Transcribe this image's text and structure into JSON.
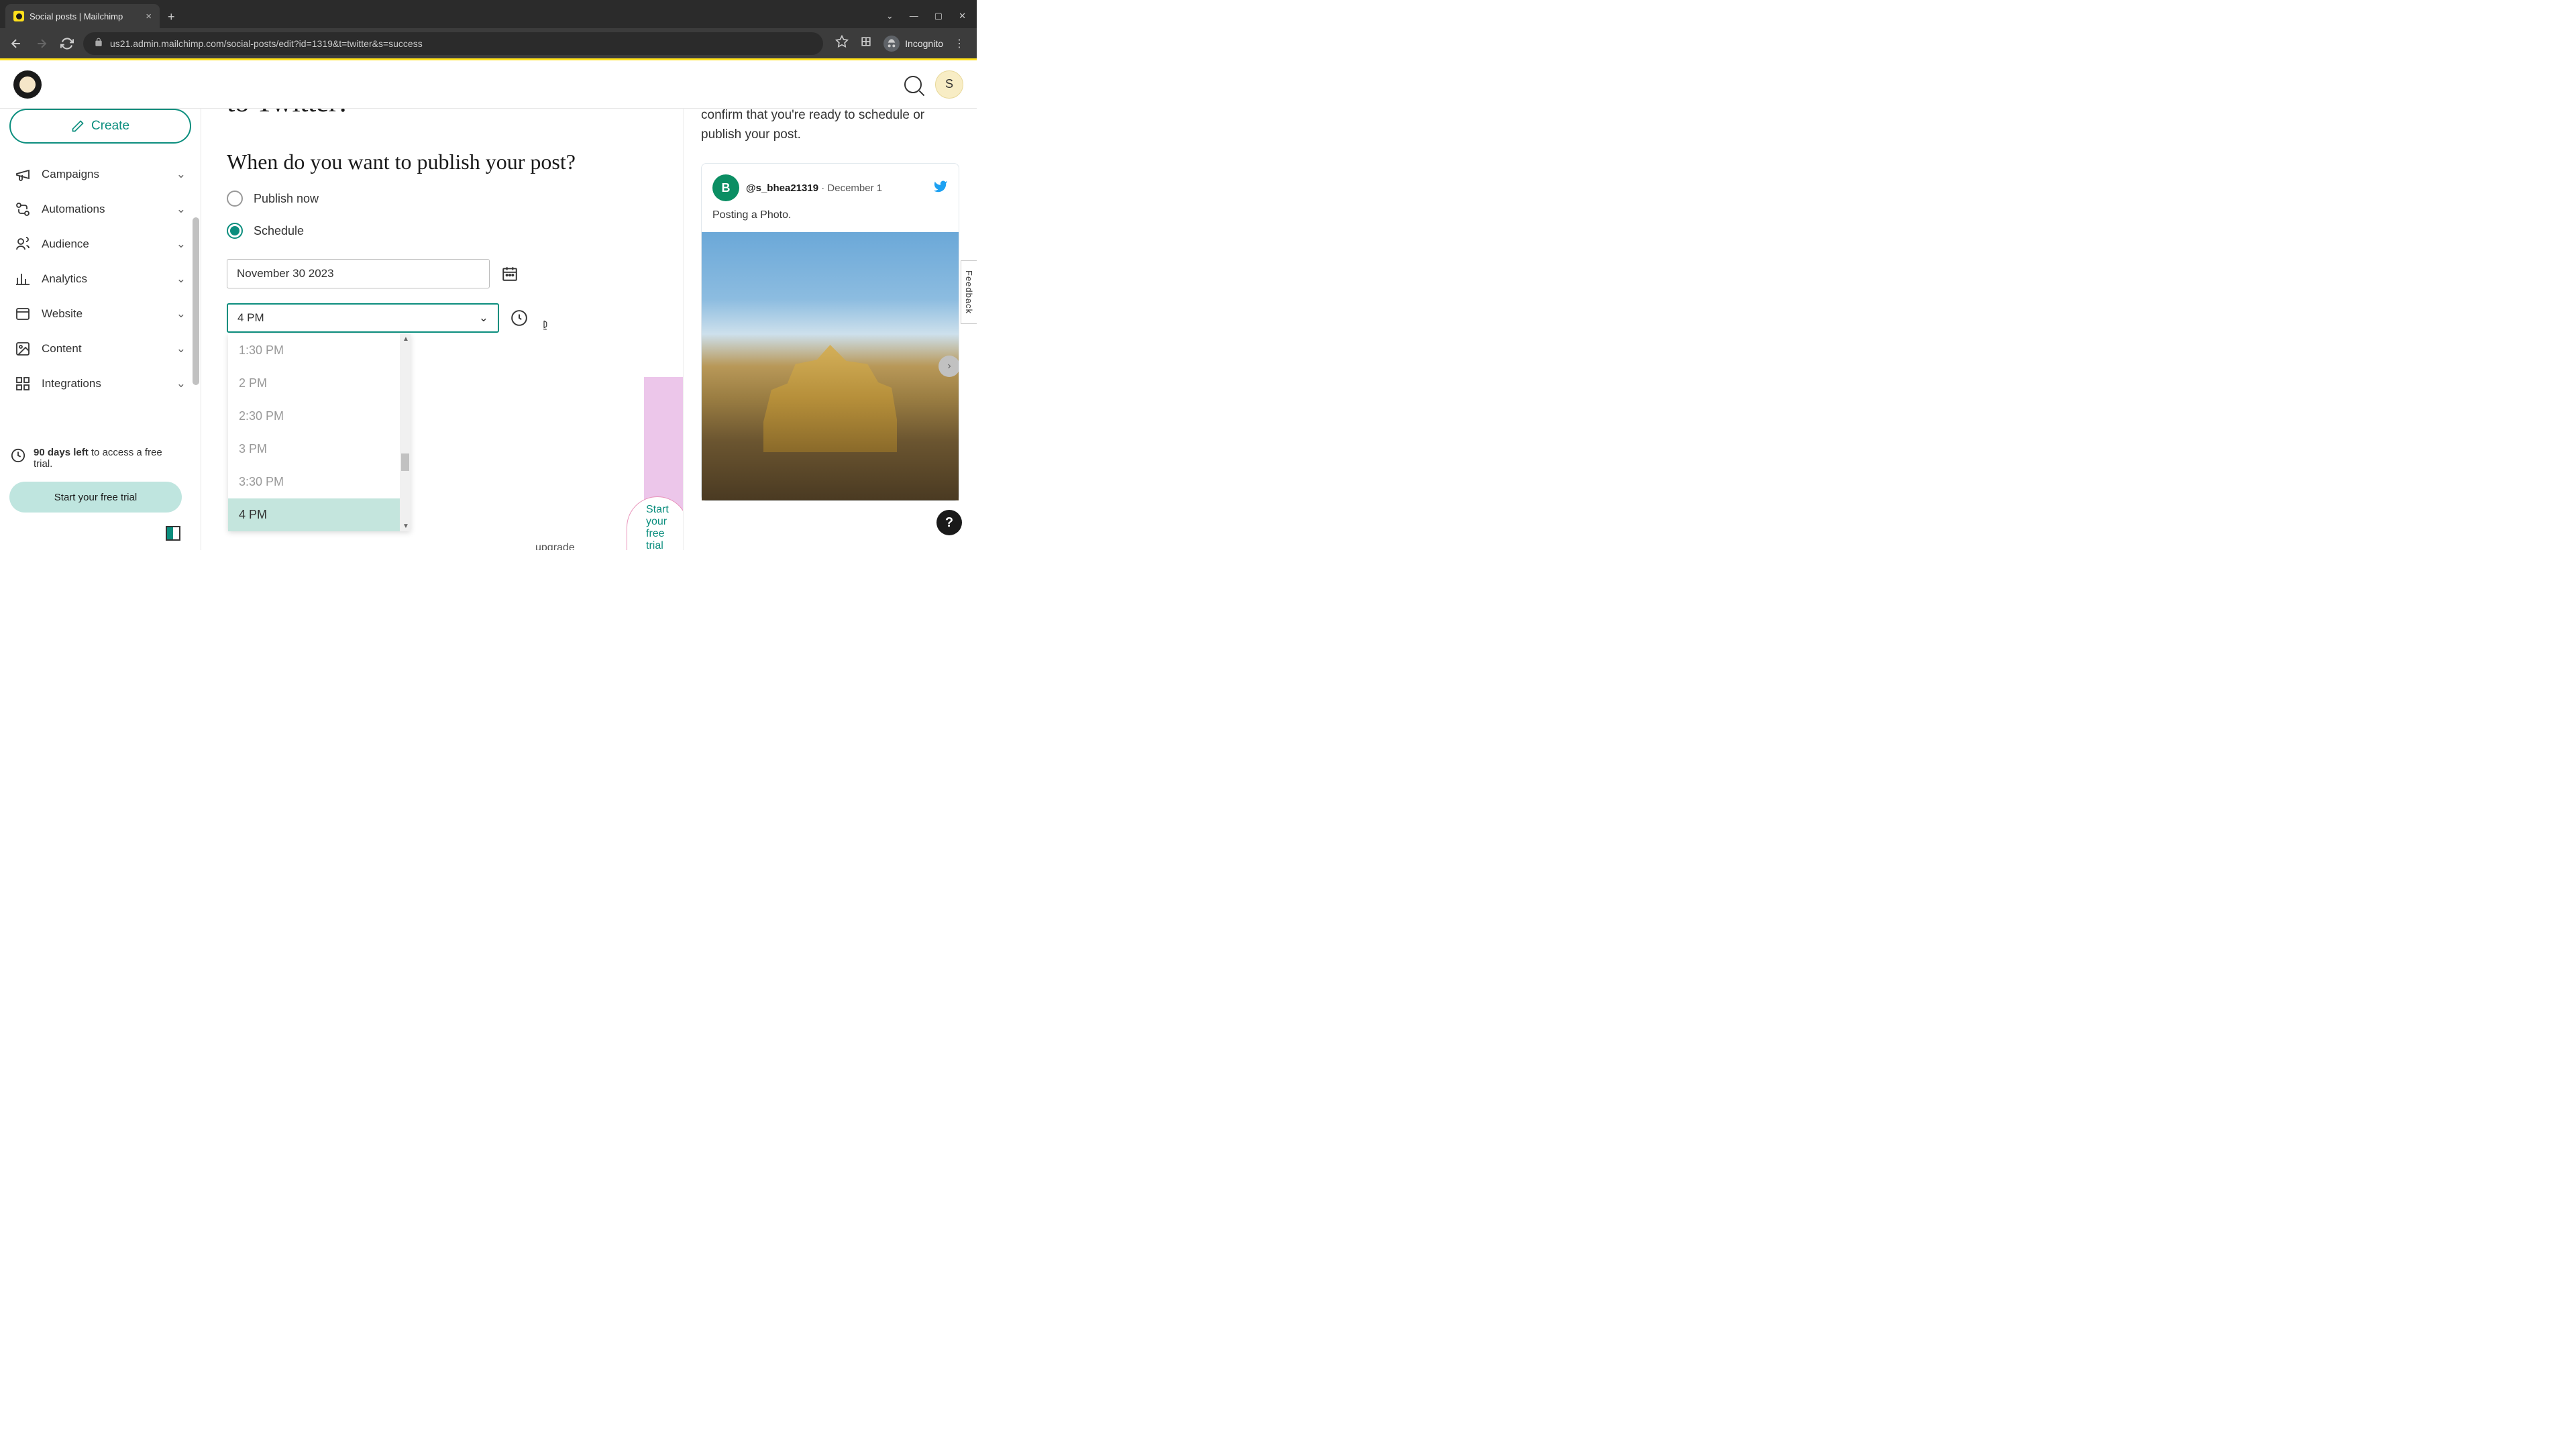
{
  "browser": {
    "tab_title": "Social posts | Mailchimp",
    "url": "us21.admin.mailchimp.com/social-posts/edit?id=1319&t=twitter&s=success",
    "incognito_label": "Incognito"
  },
  "header": {
    "avatar_letter": "S"
  },
  "sidebar": {
    "create_label": "Create",
    "items": [
      {
        "label": "Campaigns"
      },
      {
        "label": "Automations"
      },
      {
        "label": "Audience"
      },
      {
        "label": "Analytics"
      },
      {
        "label": "Website"
      },
      {
        "label": "Content"
      },
      {
        "label": "Integrations"
      }
    ],
    "trial_days_bold": "90 days left",
    "trial_days_rest": " to access a free trial.",
    "trial_cta": "Start your free trial"
  },
  "main": {
    "heading_partial": "to Twitter!",
    "subheading": "When do you want to publish your post?",
    "radio_publish_now": "Publish now",
    "radio_schedule": "Schedule",
    "date_value": "November 30 2023",
    "time_value": "4 PM",
    "time_options": [
      "1:30 PM",
      "2 PM",
      "2:30 PM",
      "3 PM",
      "3:30 PM",
      "4 PM"
    ],
    "time_selected_index": 5,
    "upgrade_peek": "upgrade",
    "trial_pill_peek": "Start your free trial"
  },
  "preview": {
    "confirm_text": "confirm that you're ready to schedule or publish your post.",
    "tweet_avatar_letter": "B",
    "tweet_handle": "@s_bhea21319",
    "tweet_date": "December 1",
    "tweet_body": "Posting a Photo."
  },
  "feedback_label": "Feedback",
  "help_label": "?"
}
